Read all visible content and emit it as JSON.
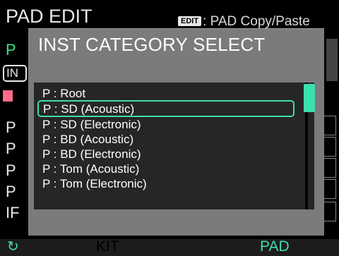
{
  "background": {
    "title": "PAD EDIT",
    "hint_key": "EDIT",
    "hint_text": ": PAD Copy/Paste",
    "rows": [
      "P",
      "IN",
      "P",
      "P",
      "P",
      "P",
      "IF"
    ]
  },
  "dialog": {
    "title": "INST CATEGORY SELECT",
    "items": [
      "P : Root",
      "P : SD (Acoustic)",
      "P : SD (Electronic)",
      "P : BD (Acoustic)",
      "P : BD (Electronic)",
      "P : Tom (Acoustic)",
      "P : Tom (Electronic)"
    ],
    "selected_index": 1
  },
  "bottom_bar": {
    "icon": "reload-icon",
    "kit_label": "KIT",
    "pad_label": "PAD"
  },
  "colors": {
    "accent": "#3cdfae",
    "green_text": "#3ce08a",
    "pink": "#ff6c8a",
    "dialog_bg": "#7b7b7b",
    "list_bg": "#262626"
  }
}
